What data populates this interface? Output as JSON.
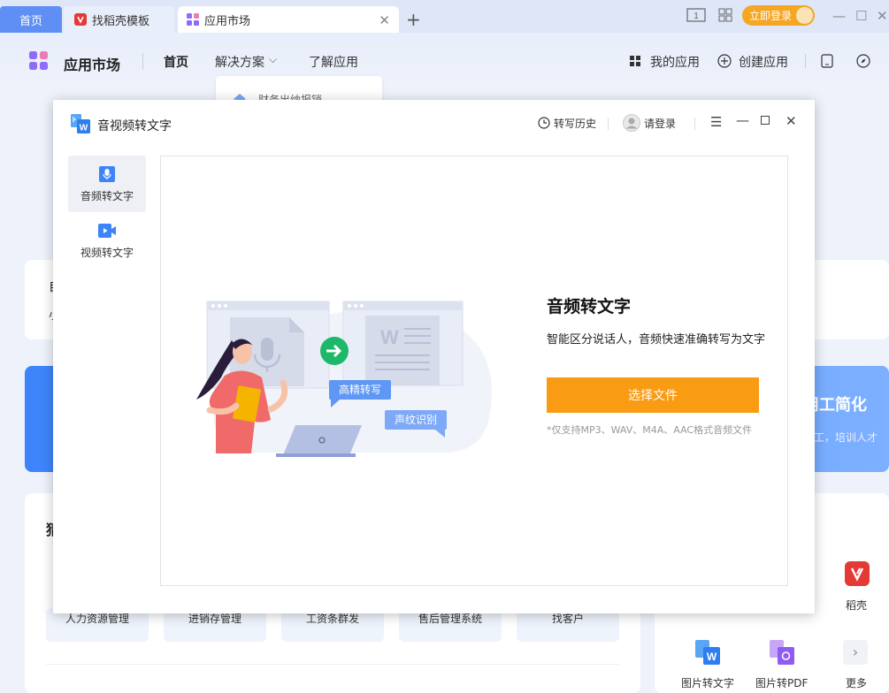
{
  "browser": {
    "tabs": [
      {
        "label": "首页"
      },
      {
        "label": "找稻壳模板"
      },
      {
        "label": "应用市场"
      }
    ],
    "login_label": "立即登录"
  },
  "header": {
    "brand": "应用市场",
    "nav": [
      "首页",
      "解决方案",
      "了解应用"
    ],
    "dropdown_peek": "财务出纳报销",
    "my_apps": "我的应用",
    "create_app": "创建应用"
  },
  "background": {
    "banner_title": "用工简化",
    "banner_sub": "员工，培训人才",
    "left_letter_1": "自",
    "left_letter_2": "小",
    "section_letter": "猜",
    "business_tags": [
      "人力资源管理",
      "进销存管理",
      "工资条群发",
      "售后管理系统",
      "找客户"
    ],
    "side_apps": [
      {
        "label": "稻壳"
      },
      {
        "label": "图片转文字"
      },
      {
        "label": "图片转PDF"
      },
      {
        "label": "更多"
      }
    ]
  },
  "modal": {
    "title": "音视频转文字",
    "history": "转写历史",
    "login": "请登录",
    "sidebar": [
      {
        "label": "音频转文字"
      },
      {
        "label": "视频转文字"
      }
    ],
    "heading": "音频转文字",
    "description": "智能区分说话人，音频快速准确转写为文字",
    "button": "选择文件",
    "note": "*仅支持MP3、WAV、M4A、AAC格式音频文件",
    "bubble_1": "高精转写",
    "bubble_2": "声纹识别"
  },
  "colors": {
    "accent": "#fa9b14",
    "primary_blue": "#3d84fb",
    "tab_active": "#5f8ff5",
    "login_pill": "#f5a623"
  }
}
